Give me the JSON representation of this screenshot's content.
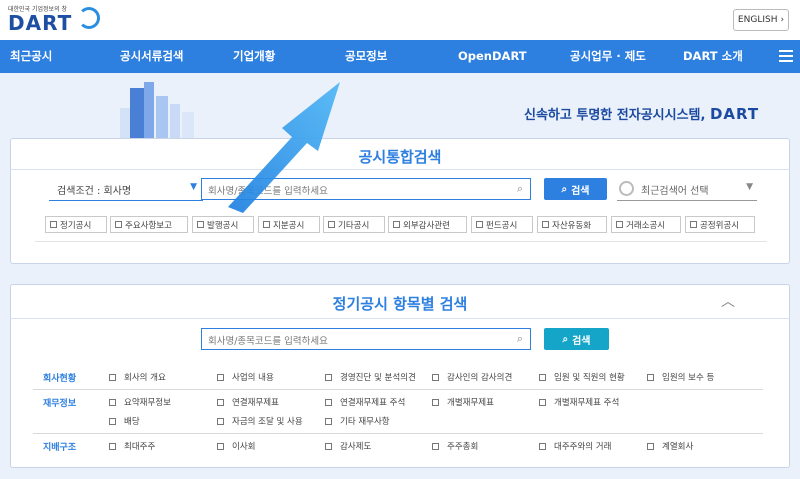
{
  "header": {
    "logo_tagline": "대한민국 기업정보의 창",
    "logo_text": "DART",
    "lang_button": "ENGLISH"
  },
  "nav": {
    "items": [
      "최근공시",
      "공시서류검색",
      "기업개황",
      "공모정보",
      "OpenDART",
      "공시업무 · 제도",
      "DART 소개"
    ]
  },
  "hero": {
    "tagline": "신속하고 투명한 전자공시시스템,",
    "brand": "DART"
  },
  "search_card": {
    "title": "공시통합검색",
    "condition": "검색조건 : 회사명",
    "input_placeholder": "회사명/종목코드를 입력하세요",
    "search_label": "검색",
    "recent_label": "최근검색어 선택",
    "filters": [
      "정기공시",
      "주요사항보고",
      "발행공시",
      "지분공시",
      "기타공시",
      "외부감사관련",
      "펀드공시",
      "자산유동화",
      "거래소공시",
      "공정위공시"
    ]
  },
  "item_card": {
    "title": "정기공시 항목별 검색",
    "input_placeholder": "회사명/종목코드를 입력하세요",
    "search_label": "검색",
    "rows": [
      {
        "label": "회사현황",
        "items": [
          "회사의 개요",
          "사업의 내용",
          "경영진단 및 분석의견",
          "감사인의 감사의견",
          "임원 및 직원의 현황",
          "임원의 보수 등"
        ]
      },
      {
        "label": "재무정보",
        "items": [
          "요약재무정보",
          "연결재무제표",
          "연결재무제표 주석",
          "개별재무제표",
          "개별재무제표 주석",
          "배당",
          "자금의 조달 및 사용",
          "기타 재무사항"
        ]
      },
      {
        "label": "지배구조",
        "items": [
          "최대주주",
          "이사회",
          "감사제도",
          "주주총회",
          "대주주와의 거래",
          "계열회사"
        ]
      }
    ]
  },
  "colors": {
    "primary": "#2d7fe0",
    "brand": "#1e4fa3"
  }
}
